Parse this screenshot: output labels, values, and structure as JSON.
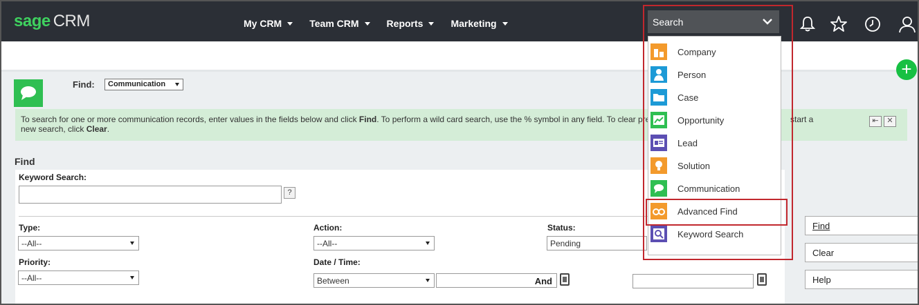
{
  "app": {
    "logo_brand": "sage",
    "logo_product": "CRM"
  },
  "nav": {
    "items": [
      {
        "label": "My CRM"
      },
      {
        "label": "Team CRM"
      },
      {
        "label": "Reports"
      },
      {
        "label": "Marketing"
      }
    ]
  },
  "search": {
    "label": "Search",
    "options": [
      {
        "label": "Company",
        "icon": "company-icon",
        "color": "#f39a2c"
      },
      {
        "label": "Person",
        "icon": "person-icon",
        "color": "#1d9ad6"
      },
      {
        "label": "Case",
        "icon": "case-folder-icon",
        "color": "#1d9ad6"
      },
      {
        "label": "Opportunity",
        "icon": "opportunity-chart-icon",
        "color": "#2fbf52"
      },
      {
        "label": "Lead",
        "icon": "lead-card-icon",
        "color": "#5c4fb3"
      },
      {
        "label": "Solution",
        "icon": "solution-bulb-icon",
        "color": "#f39a2c"
      },
      {
        "label": "Communication",
        "icon": "communication-bubble-icon",
        "color": "#2fbf52"
      },
      {
        "label": "Advanced Find",
        "icon": "binoculars-icon",
        "color": "#f39a2c"
      },
      {
        "label": "Keyword Search",
        "icon": "keyword-search-icon",
        "color": "#5c4fb3"
      }
    ]
  },
  "find_bar": {
    "label": "Find:",
    "entity": "Communication"
  },
  "info": {
    "text_1": "To search for one or more communication records, enter values in the fields below and click ",
    "bold_1": "Find",
    "text_2": ". To perform a wild card search, use the % symbol in any field. To clear pre",
    "text_3": "start a",
    "text_4": "new search, click ",
    "bold_2": "Clear",
    "text_5": "."
  },
  "form": {
    "heading": "Find",
    "keyword_label": "Keyword Search:",
    "keyword_value": "",
    "help": "?",
    "type_label": "Type:",
    "type_value": "--All--",
    "action_label": "Action:",
    "action_value": "--All--",
    "status_label": "Status:",
    "status_value": "Pending",
    "priority_label": "Priority:",
    "priority_value": "--All--",
    "datetime_label": "Date / Time:",
    "datetime_mode": "Between",
    "and_label": "And"
  },
  "buttons": {
    "find": "Find",
    "clear": "Clear",
    "help": "Help"
  },
  "colors": {
    "topbar": "#2b2f36",
    "brand_green": "#3fd15f",
    "highlight_red": "#c1272d",
    "info_green": "#d4edd7"
  }
}
